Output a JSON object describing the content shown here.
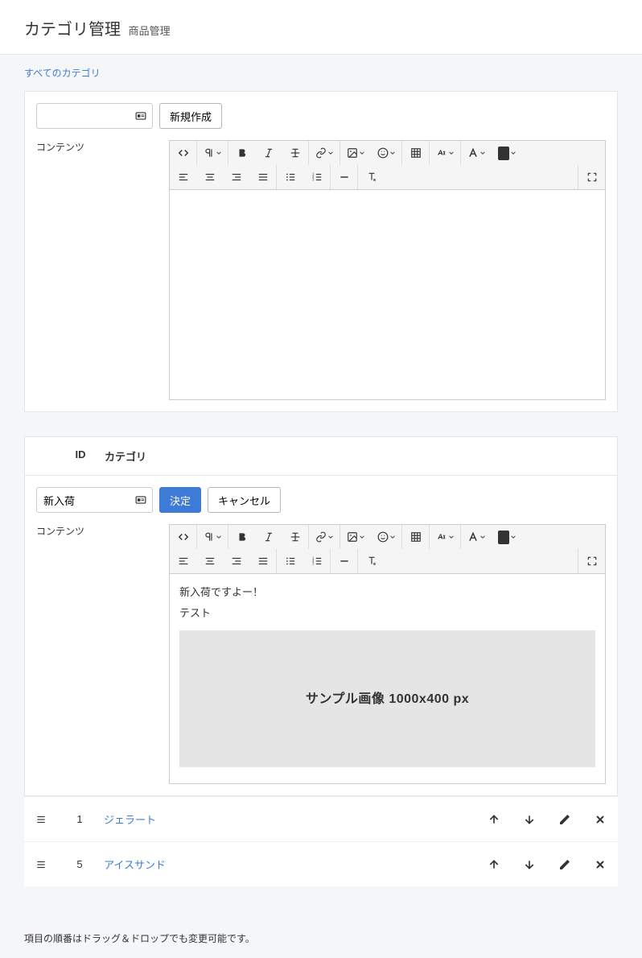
{
  "header": {
    "title": "カテゴリ管理",
    "subtitle": "商品管理"
  },
  "breadcrumb": {
    "all": "すべてのカテゴリ"
  },
  "form1": {
    "input_value": "",
    "create_btn": "新規作成",
    "content_label": "コンテンツ"
  },
  "table_header": {
    "id": "ID",
    "category": "カテゴリ"
  },
  "form2": {
    "input_value": "新入荷",
    "submit_btn": "決定",
    "cancel_btn": "キャンセル",
    "content_label": "コンテンツ",
    "editor_line1": "新入荷ですよー！",
    "editor_line2": "テスト",
    "sample_img_text": "サンプル画像 1000x400 px"
  },
  "list": [
    {
      "id": "1",
      "name": "ジェラート"
    },
    {
      "id": "5",
      "name": "アイスサンド"
    }
  ],
  "footer_note": "項目の順番はドラッグ＆ドロップでも変更可能です。"
}
